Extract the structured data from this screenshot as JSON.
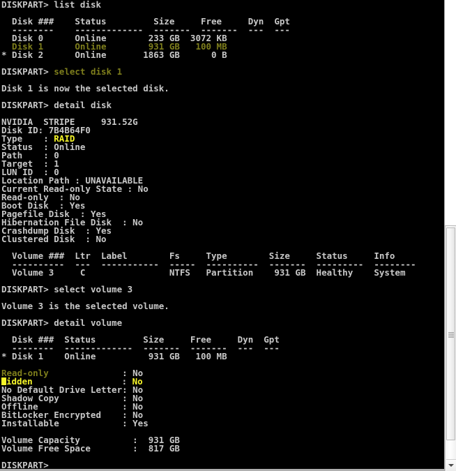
{
  "app": {
    "name": "diskpart-console",
    "prompt": "DISKPART>",
    "colors": {
      "background": "#000000",
      "text": "#c8c8c8",
      "olive_yellow": "#7e7e1c",
      "bright_yellow": "#f6f629"
    }
  },
  "commands": {
    "list_disk": "list disk",
    "select_disk": "select disk 1",
    "detail_disk": "detail disk",
    "select_volume": "select volume 3",
    "detail_volume": "detail volume"
  },
  "list_disk_table": {
    "headers": [
      "Disk ###",
      "Status",
      "Size",
      "Free",
      "Dyn",
      "Gpt"
    ],
    "underlines": [
      "--------",
      "-------------",
      "-------",
      "-------",
      "---",
      "---"
    ],
    "rows": [
      {
        "marker": " ",
        "disk": "Disk 0",
        "status": "Online",
        "size": "233 GB",
        "free": "3072 KB",
        "dyn": "",
        "gpt": "",
        "highlight": false
      },
      {
        "marker": " ",
        "disk": "Disk 1",
        "status": "Online",
        "size": "931 GB",
        "free": "100 MB",
        "dyn": "",
        "gpt": "",
        "highlight": true
      },
      {
        "marker": "*",
        "disk": "Disk 2",
        "status": "Online",
        "size": "1863 GB",
        "free": "0 B",
        "dyn": "",
        "gpt": "",
        "highlight": false
      }
    ]
  },
  "select_disk_result": "Disk 1 is now the selected disk.",
  "disk_detail": {
    "model": "NVIDIA  STRIPE     931.52G",
    "disk_id_label": "Disk ID:",
    "disk_id_value": "7B4B64F0",
    "type_label": "Type    : ",
    "type_value": "RAID",
    "fields": [
      {
        "label": "Status  : ",
        "value": "Online"
      },
      {
        "label": "Path    : ",
        "value": "0"
      },
      {
        "label": "Target  : ",
        "value": "1"
      },
      {
        "label": "LUN ID  : ",
        "value": "0"
      },
      {
        "label": "Location Path : ",
        "value": "UNAVAILABLE"
      },
      {
        "label": "Current Read-only State : ",
        "value": "No"
      },
      {
        "label": "Read-only  : ",
        "value": "No"
      },
      {
        "label": "Boot Disk  : ",
        "value": "Yes"
      },
      {
        "label": "Pagefile Disk  : ",
        "value": "Yes"
      },
      {
        "label": "Hibernation File Disk  : ",
        "value": "No"
      },
      {
        "label": "Crashdump Disk  : ",
        "value": "Yes"
      },
      {
        "label": "Clustered Disk  : ",
        "value": "No"
      }
    ]
  },
  "volume_table": {
    "headers": [
      "Volume ###",
      "Ltr",
      "Label",
      "Fs",
      "Type",
      "Size",
      "Status",
      "Info"
    ],
    "underline_row": "  ----------  ---  -----------  -----  ----------  -------  ---------  --------",
    "header_row": "  Volume ###  Ltr  Label        Fs     Type        Size     Status     Info",
    "rows": [
      "  Volume 3     C                NTFS   Partition    931 GB  Healthy    System"
    ]
  },
  "select_volume_result": "Volume 3 is the selected volume.",
  "volume_detail": {
    "disk_table": {
      "header_row": "  Disk ###  Status         Size     Free     Dyn  Gpt",
      "underline_row": "  --------  -------------  -------  -------  ---  ---",
      "row": "* Disk 1    Online          931 GB   100 MB"
    },
    "flags": [
      {
        "label": "Read-only",
        "sep": ": ",
        "value": "No",
        "label_color": "olive",
        "value_color": "white",
        "cursor": false
      },
      {
        "label": "Hidden",
        "sep": ": ",
        "value": "No",
        "label_color": "bright",
        "value_color": "bright",
        "cursor": true
      },
      {
        "label": "No Default Drive Letter",
        "sep": ": ",
        "value": "No",
        "label_color": "white",
        "value_color": "white",
        "cursor": false
      },
      {
        "label": "Shadow Copy",
        "sep": ": ",
        "value": "No",
        "label_color": "white",
        "value_color": "white",
        "cursor": false
      },
      {
        "label": "Offline",
        "sep": ": ",
        "value": "No",
        "label_color": "white",
        "value_color": "white",
        "cursor": false
      },
      {
        "label": "BitLocker Encrypted",
        "sep": ": ",
        "value": "No",
        "label_color": "white",
        "value_color": "white",
        "cursor": false
      },
      {
        "label": "Installable",
        "sep": ": ",
        "value": "Yes",
        "label_color": "white",
        "value_color": "white",
        "cursor": false
      }
    ],
    "capacity": [
      {
        "label": "Volume Capacity",
        "value": "931 GB"
      },
      {
        "label": "Volume Free Space",
        "value": "817 GB"
      }
    ]
  },
  "scrollbar": {
    "down_arrow_icon": "chevron-down-icon",
    "grip_icon": "grip-lines-icon"
  }
}
